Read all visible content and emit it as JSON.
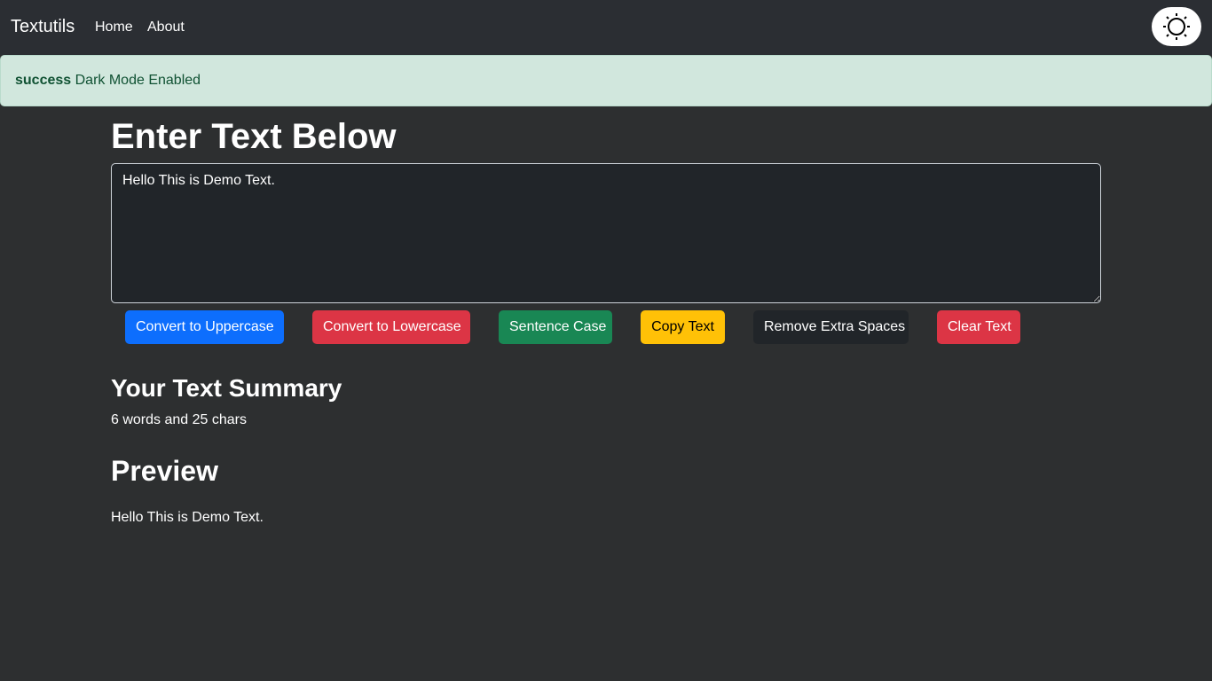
{
  "navbar": {
    "brand": "Textutils",
    "links": [
      {
        "label": "Home"
      },
      {
        "label": "About"
      }
    ],
    "mode_toggle_icon": "sun-icon"
  },
  "alert": {
    "type": "success",
    "message": "Dark Mode Enabled",
    "color": "#d1e7dd"
  },
  "form": {
    "heading": "Enter Text Below",
    "text_value": "Hello This is Demo Text."
  },
  "buttons": {
    "uppercase": "Convert to Uppercase",
    "lowercase": "Convert to Lowercase",
    "sentence": "Sentence Case",
    "copy": "Copy Text",
    "remove_spaces": "Remove Extra Spaces",
    "clear": "Clear Text"
  },
  "summary": {
    "heading": "Your Text Summary",
    "stats": "6 words and 25 chars"
  },
  "preview": {
    "heading": "Preview",
    "text": "Hello This is Demo Text."
  },
  "colors": {
    "primary": "#0d6efd",
    "danger": "#dc3545",
    "success": "#198754",
    "warning": "#ffc107",
    "dark": "#212529",
    "background": "#2d2f30"
  }
}
